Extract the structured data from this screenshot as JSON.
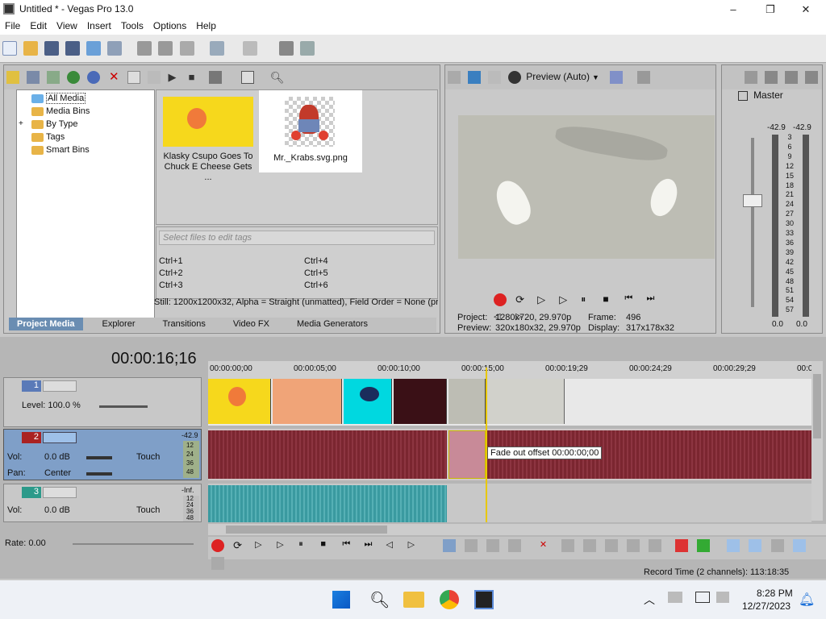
{
  "window": {
    "title": "Untitled * - Vegas Pro 13.0",
    "min": "–",
    "max": "❐",
    "close": "✕"
  },
  "menu": [
    "File",
    "Edit",
    "View",
    "Insert",
    "Tools",
    "Options",
    "Help"
  ],
  "media": {
    "tree": [
      "All Media",
      "Media Bins",
      "By Type",
      "Tags",
      "Smart Bins"
    ],
    "expand": "+",
    "thumbs": [
      {
        "label": "Klasky Csupo Goes To Chuck E Cheese Gets ..."
      },
      {
        "label": "Mr._Krabs.svg.png"
      }
    ],
    "tag_placeholder": "Select files to edit tags",
    "shortcuts": [
      "Ctrl+1",
      "Ctrl+4",
      "Ctrl+2",
      "Ctrl+5",
      "Ctrl+3",
      "Ctrl+6"
    ],
    "status": "Still: 1200x1200x32, Alpha = Straight (unmatted), Field Order = None (pr",
    "tabs": [
      "Project Media",
      "Explorer",
      "Transitions",
      "Video FX",
      "Media Generators"
    ]
  },
  "preview": {
    "mode": "Preview (Auto)",
    "project_label": "Project:",
    "project_value": "1280x720, 29.970p",
    "frame_label": "Frame:",
    "frame_value": "496",
    "preview_label": "Preview:",
    "preview_value": "320x180x32, 29.970p",
    "display_label": "Display:",
    "display_value": "317x178x32"
  },
  "master": {
    "title": "Master",
    "peak_l": "-42.9",
    "peak_r": "-42.9",
    "scale": [
      "3",
      "6",
      "9",
      "12",
      "15",
      "18",
      "21",
      "24",
      "27",
      "30",
      "33",
      "36",
      "39",
      "42",
      "45",
      "48",
      "51",
      "54",
      "57"
    ],
    "bottom_l": "0.0",
    "bottom_r": "0.0"
  },
  "timeline": {
    "timecode": "00:00:16;16",
    "ruler": [
      "00:00:00;00",
      "00:00:05;00",
      "00:00:10;00",
      "00:00:15;00",
      "00:00:19;29",
      "00:00:24;29",
      "00:00:29;29",
      "00:0"
    ],
    "tracks": [
      {
        "num": "1",
        "level": "Level: 100.0 %"
      },
      {
        "num": "2",
        "vol": "Vol:",
        "vol_value": "0.0 dB",
        "pan": "Pan:",
        "pan_value": "Center",
        "mode": "Touch",
        "peak": "-42.9",
        "meter": [
          "12",
          "24",
          "36",
          "48"
        ]
      },
      {
        "num": "3",
        "vol": "Vol:",
        "vol_value": "0.0 dB",
        "mode": "Touch",
        "peak": "-Inf.",
        "meter": [
          "12",
          "24",
          "36",
          "48"
        ]
      }
    ],
    "tooltip": "Fade out offset 00:00:00;00",
    "rate": "Rate: 0.00",
    "record_time": "Record Time (2 channels): 113:18:35"
  },
  "taskbar": {
    "time": "8:28 PM",
    "date": "12/27/2023"
  },
  "colors": {
    "accent": "#6a8db2",
    "video_track": "#7fa1c8",
    "audio_wave": "#7b2630",
    "audio_wave2": "#3a9aa0",
    "clip_yellow": "#f6d81c"
  }
}
